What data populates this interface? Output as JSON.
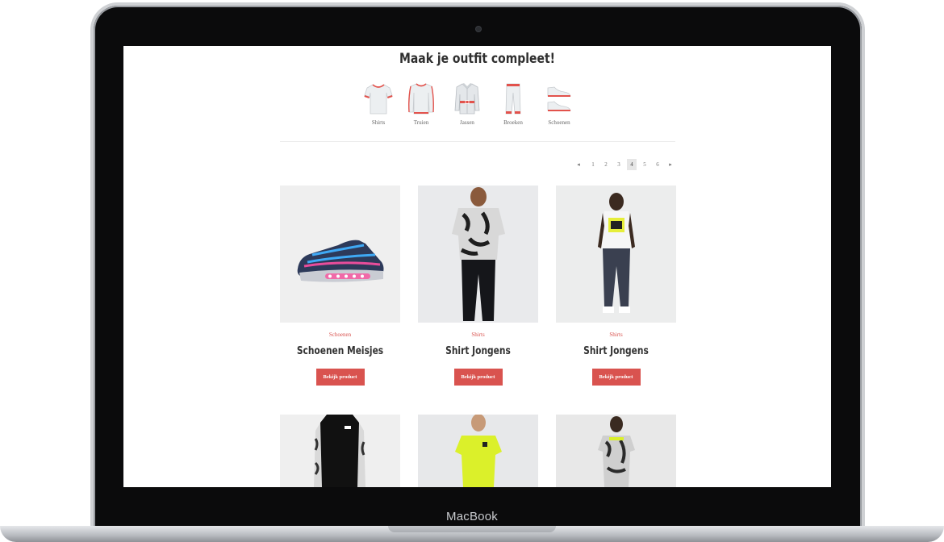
{
  "device": {
    "brand_label": "MacBook"
  },
  "section": {
    "title": "Maak je outfit compleet!"
  },
  "categories": [
    {
      "label": "Shirts",
      "icon": "tshirt-icon"
    },
    {
      "label": "Truien",
      "icon": "sweater-icon"
    },
    {
      "label": "Jassen",
      "icon": "jacket-icon"
    },
    {
      "label": "Broeken",
      "icon": "pants-icon"
    },
    {
      "label": "Schoenen",
      "icon": "shoes-icon"
    }
  ],
  "pagination": {
    "prev": "◂",
    "pages": [
      "1",
      "2",
      "3",
      "4",
      "5",
      "6"
    ],
    "active": "4",
    "next": "▸"
  },
  "products": [
    {
      "category": "Schoenen",
      "title": "Schoenen Meisjes",
      "button": "Bekijk product",
      "image": "sneaker"
    },
    {
      "category": "Shirts",
      "title": "Shirt Jongens",
      "button": "Bekijk product",
      "image": "kid-camo-shirt"
    },
    {
      "category": "Shirts",
      "title": "Shirt Jongens",
      "button": "Bekijk product",
      "image": "kid-white-shirt"
    },
    {
      "image": "kid-black-sweater"
    },
    {
      "image": "kid-yellow-shirt"
    },
    {
      "image": "kid-camo-tee"
    }
  ],
  "colors": {
    "accent": "#d9534f",
    "text": "#333333",
    "image_bg": "#efefef"
  }
}
